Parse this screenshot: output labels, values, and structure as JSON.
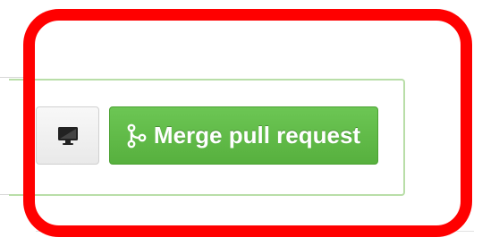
{
  "merge_panel": {
    "merge_button_label": "Merge pull request",
    "merge_icon": "git-merge-icon",
    "desktop_icon": "desktop-icon"
  },
  "colors": {
    "merge_button": "#5dba43",
    "panel_border": "#b9dea8",
    "highlight": "#ff0000"
  }
}
